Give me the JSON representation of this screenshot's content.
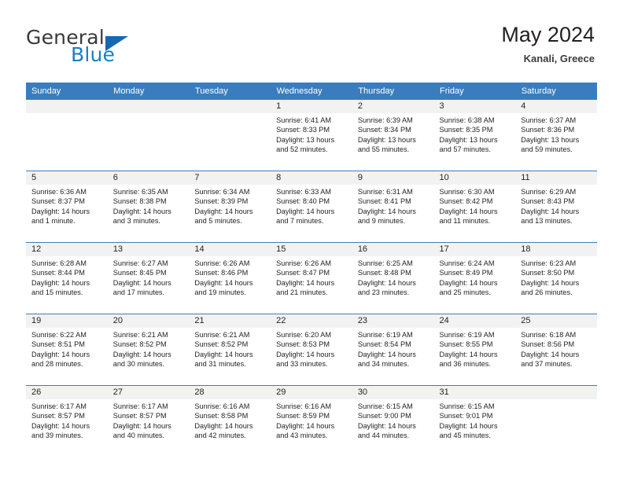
{
  "brand": {
    "word_one": "General",
    "word_two": "Blue",
    "triangle_icon": "blue-triangle-logo-mark",
    "colors": {
      "general_text": "#3a3a3a",
      "blue_text": "#1a7fc1",
      "triangle": "#1668b0"
    }
  },
  "header": {
    "title": "May 2024",
    "subtitle": "Kanali, Greece"
  },
  "calendar": {
    "accent_color": "#3a7dbf",
    "daynum_band_color": "#f2f2f2",
    "weekday_headers": [
      "Sunday",
      "Monday",
      "Tuesday",
      "Wednesday",
      "Thursday",
      "Friday",
      "Saturday"
    ],
    "weeks": [
      [
        {
          "day": "",
          "lines": []
        },
        {
          "day": "",
          "lines": []
        },
        {
          "day": "",
          "lines": []
        },
        {
          "day": "1",
          "lines": [
            "Sunrise: 6:41 AM",
            "Sunset: 8:33 PM",
            "Daylight: 13 hours",
            "and 52 minutes."
          ]
        },
        {
          "day": "2",
          "lines": [
            "Sunrise: 6:39 AM",
            "Sunset: 8:34 PM",
            "Daylight: 13 hours",
            "and 55 minutes."
          ]
        },
        {
          "day": "3",
          "lines": [
            "Sunrise: 6:38 AM",
            "Sunset: 8:35 PM",
            "Daylight: 13 hours",
            "and 57 minutes."
          ]
        },
        {
          "day": "4",
          "lines": [
            "Sunrise: 6:37 AM",
            "Sunset: 8:36 PM",
            "Daylight: 13 hours",
            "and 59 minutes."
          ]
        }
      ],
      [
        {
          "day": "5",
          "lines": [
            "Sunrise: 6:36 AM",
            "Sunset: 8:37 PM",
            "Daylight: 14 hours",
            "and 1 minute."
          ]
        },
        {
          "day": "6",
          "lines": [
            "Sunrise: 6:35 AM",
            "Sunset: 8:38 PM",
            "Daylight: 14 hours",
            "and 3 minutes."
          ]
        },
        {
          "day": "7",
          "lines": [
            "Sunrise: 6:34 AM",
            "Sunset: 8:39 PM",
            "Daylight: 14 hours",
            "and 5 minutes."
          ]
        },
        {
          "day": "8",
          "lines": [
            "Sunrise: 6:33 AM",
            "Sunset: 8:40 PM",
            "Daylight: 14 hours",
            "and 7 minutes."
          ]
        },
        {
          "day": "9",
          "lines": [
            "Sunrise: 6:31 AM",
            "Sunset: 8:41 PM",
            "Daylight: 14 hours",
            "and 9 minutes."
          ]
        },
        {
          "day": "10",
          "lines": [
            "Sunrise: 6:30 AM",
            "Sunset: 8:42 PM",
            "Daylight: 14 hours",
            "and 11 minutes."
          ]
        },
        {
          "day": "11",
          "lines": [
            "Sunrise: 6:29 AM",
            "Sunset: 8:43 PM",
            "Daylight: 14 hours",
            "and 13 minutes."
          ]
        }
      ],
      [
        {
          "day": "12",
          "lines": [
            "Sunrise: 6:28 AM",
            "Sunset: 8:44 PM",
            "Daylight: 14 hours",
            "and 15 minutes."
          ]
        },
        {
          "day": "13",
          "lines": [
            "Sunrise: 6:27 AM",
            "Sunset: 8:45 PM",
            "Daylight: 14 hours",
            "and 17 minutes."
          ]
        },
        {
          "day": "14",
          "lines": [
            "Sunrise: 6:26 AM",
            "Sunset: 8:46 PM",
            "Daylight: 14 hours",
            "and 19 minutes."
          ]
        },
        {
          "day": "15",
          "lines": [
            "Sunrise: 6:26 AM",
            "Sunset: 8:47 PM",
            "Daylight: 14 hours",
            "and 21 minutes."
          ]
        },
        {
          "day": "16",
          "lines": [
            "Sunrise: 6:25 AM",
            "Sunset: 8:48 PM",
            "Daylight: 14 hours",
            "and 23 minutes."
          ]
        },
        {
          "day": "17",
          "lines": [
            "Sunrise: 6:24 AM",
            "Sunset: 8:49 PM",
            "Daylight: 14 hours",
            "and 25 minutes."
          ]
        },
        {
          "day": "18",
          "lines": [
            "Sunrise: 6:23 AM",
            "Sunset: 8:50 PM",
            "Daylight: 14 hours",
            "and 26 minutes."
          ]
        }
      ],
      [
        {
          "day": "19",
          "lines": [
            "Sunrise: 6:22 AM",
            "Sunset: 8:51 PM",
            "Daylight: 14 hours",
            "and 28 minutes."
          ]
        },
        {
          "day": "20",
          "lines": [
            "Sunrise: 6:21 AM",
            "Sunset: 8:52 PM",
            "Daylight: 14 hours",
            "and 30 minutes."
          ]
        },
        {
          "day": "21",
          "lines": [
            "Sunrise: 6:21 AM",
            "Sunset: 8:52 PM",
            "Daylight: 14 hours",
            "and 31 minutes."
          ]
        },
        {
          "day": "22",
          "lines": [
            "Sunrise: 6:20 AM",
            "Sunset: 8:53 PM",
            "Daylight: 14 hours",
            "and 33 minutes."
          ]
        },
        {
          "day": "23",
          "lines": [
            "Sunrise: 6:19 AM",
            "Sunset: 8:54 PM",
            "Daylight: 14 hours",
            "and 34 minutes."
          ]
        },
        {
          "day": "24",
          "lines": [
            "Sunrise: 6:19 AM",
            "Sunset: 8:55 PM",
            "Daylight: 14 hours",
            "and 36 minutes."
          ]
        },
        {
          "day": "25",
          "lines": [
            "Sunrise: 6:18 AM",
            "Sunset: 8:56 PM",
            "Daylight: 14 hours",
            "and 37 minutes."
          ]
        }
      ],
      [
        {
          "day": "26",
          "lines": [
            "Sunrise: 6:17 AM",
            "Sunset: 8:57 PM",
            "Daylight: 14 hours",
            "and 39 minutes."
          ]
        },
        {
          "day": "27",
          "lines": [
            "Sunrise: 6:17 AM",
            "Sunset: 8:57 PM",
            "Daylight: 14 hours",
            "and 40 minutes."
          ]
        },
        {
          "day": "28",
          "lines": [
            "Sunrise: 6:16 AM",
            "Sunset: 8:58 PM",
            "Daylight: 14 hours",
            "and 42 minutes."
          ]
        },
        {
          "day": "29",
          "lines": [
            "Sunrise: 6:16 AM",
            "Sunset: 8:59 PM",
            "Daylight: 14 hours",
            "and 43 minutes."
          ]
        },
        {
          "day": "30",
          "lines": [
            "Sunrise: 6:15 AM",
            "Sunset: 9:00 PM",
            "Daylight: 14 hours",
            "and 44 minutes."
          ]
        },
        {
          "day": "31",
          "lines": [
            "Sunrise: 6:15 AM",
            "Sunset: 9:01 PM",
            "Daylight: 14 hours",
            "and 45 minutes."
          ]
        },
        {
          "day": "",
          "lines": []
        }
      ]
    ]
  }
}
